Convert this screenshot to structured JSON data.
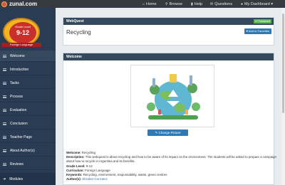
{
  "brand": {
    "name": "zunal.com"
  },
  "topnav": {
    "home": "Home",
    "browse": "Browse",
    "help": "Help",
    "questions": "Questions",
    "dashboard": "My Dashboard ▾"
  },
  "badge": {
    "level_label": "Grade Level",
    "level": "9-12",
    "subject": "Foreign Language"
  },
  "sidebar": {
    "items": [
      {
        "label": "Welcome"
      },
      {
        "label": "Introduction"
      },
      {
        "label": "Tasks"
      },
      {
        "label": "Process"
      },
      {
        "label": "Evaluation"
      },
      {
        "label": "Conclusion"
      },
      {
        "label": "Teacher Page"
      },
      {
        "label": "About Author(s)"
      },
      {
        "label": "Reviews"
      }
    ],
    "modules": "Modules"
  },
  "webquest": {
    "header": "WebQuest",
    "status": "✔ Published",
    "title": "Recycling",
    "add_favorites": "♥ Add to Favorites"
  },
  "welcome": {
    "header": "Welcome",
    "change_picture": "✎ Change Picture",
    "fields": [
      {
        "label": "Welcome:",
        "value": "Recycling"
      },
      {
        "label": "Description:",
        "value": "This webquest is about recycling and how to be aware of its impact on the environment. The students will be asked to prepare a campaign about how to recycle in Argentina and its benefits."
      },
      {
        "label": "Grade Level:",
        "value": "9-12"
      },
      {
        "label": "Curriculum:",
        "value": "Foreign Language"
      },
      {
        "label": "Keywords:",
        "value": "Recycling, environment, responsability, waste, green centres"
      },
      {
        "label": "Author(s):",
        "value": "Elizabet Gonzalez"
      }
    ]
  },
  "colors": {
    "navbar": "#343a40",
    "sidebar": "#2a3c53",
    "panel_header": "#34495e",
    "primary_button": "#2f79b5",
    "published": "#5cb85c"
  }
}
